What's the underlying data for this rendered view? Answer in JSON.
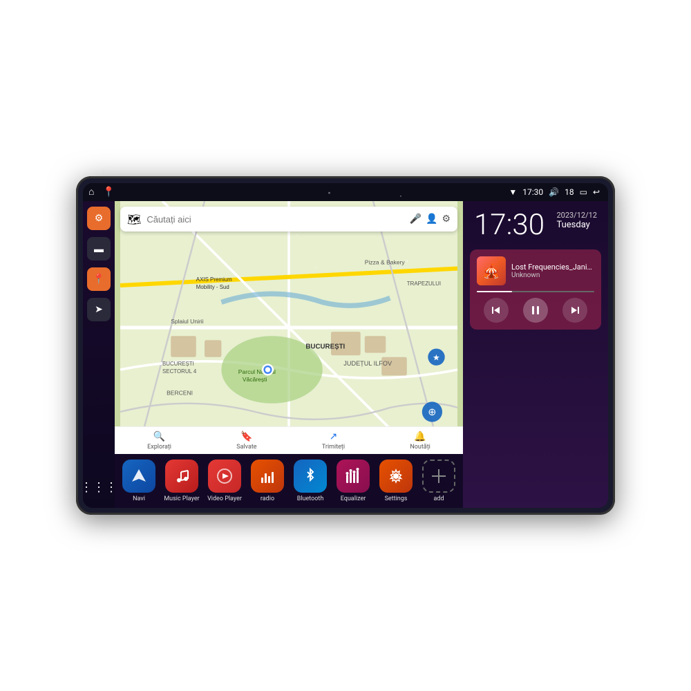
{
  "device": {
    "status_bar": {
      "time": "17:30",
      "battery": "18",
      "wifi_icon": "📶",
      "volume_icon": "🔊",
      "battery_icon": "🔋",
      "back_icon": "↩"
    },
    "sidebar": {
      "items": [
        {
          "name": "settings",
          "label": "⚙",
          "style": "orange"
        },
        {
          "name": "files",
          "label": "🗂",
          "style": "dark-gray"
        },
        {
          "name": "maps",
          "label": "📍",
          "style": "orange"
        },
        {
          "name": "navigation",
          "label": "➤",
          "style": "dark-gray"
        }
      ],
      "apps_icon": "⋮⋮⋮"
    },
    "map": {
      "search_placeholder": "Căutați aici",
      "bottom_items": [
        {
          "label": "Explorați",
          "icon": "🔍"
        },
        {
          "label": "Salvate",
          "icon": "🔖"
        },
        {
          "label": "Trimiteți",
          "icon": "↗"
        },
        {
          "label": "Noutăți",
          "icon": "🔔"
        }
      ],
      "locations": [
        {
          "name": "AXIS Premium\nMobility - Sud"
        },
        {
          "name": "Parcul Natural Văcărești"
        },
        {
          "name": "Pizza & Bakery"
        },
        {
          "name": "BUCUREȘTI"
        },
        {
          "name": "BUCUREȘTI\nSECTORUL 4"
        },
        {
          "name": "JUDEȚUL ILFOV"
        },
        {
          "name": "BERCENI"
        },
        {
          "name": "TRAPEZULUI"
        }
      ]
    },
    "clock": {
      "time": "17:30",
      "date": "2023/12/12",
      "day": "Tuesday"
    },
    "music": {
      "title": "Lost Frequencies_Janie...",
      "artist": "Unknown",
      "progress_pct": 30
    },
    "apps": [
      {
        "id": "navi",
        "label": "Navi",
        "icon": "➤",
        "style": "icon-navi"
      },
      {
        "id": "music-player",
        "label": "Music Player",
        "icon": "♪",
        "style": "icon-music"
      },
      {
        "id": "video-player",
        "label": "Video Player",
        "icon": "▶",
        "style": "icon-video"
      },
      {
        "id": "radio",
        "label": "radio",
        "icon": "📻",
        "style": "icon-radio"
      },
      {
        "id": "bluetooth",
        "label": "Bluetooth",
        "icon": "✦",
        "style": "icon-bt"
      },
      {
        "id": "equalizer",
        "label": "Equalizer",
        "icon": "🎚",
        "style": "icon-eq"
      },
      {
        "id": "settings",
        "label": "Settings",
        "icon": "⚙",
        "style": "icon-settings"
      },
      {
        "id": "add",
        "label": "add",
        "icon": "+",
        "style": "icon-add"
      }
    ]
  }
}
